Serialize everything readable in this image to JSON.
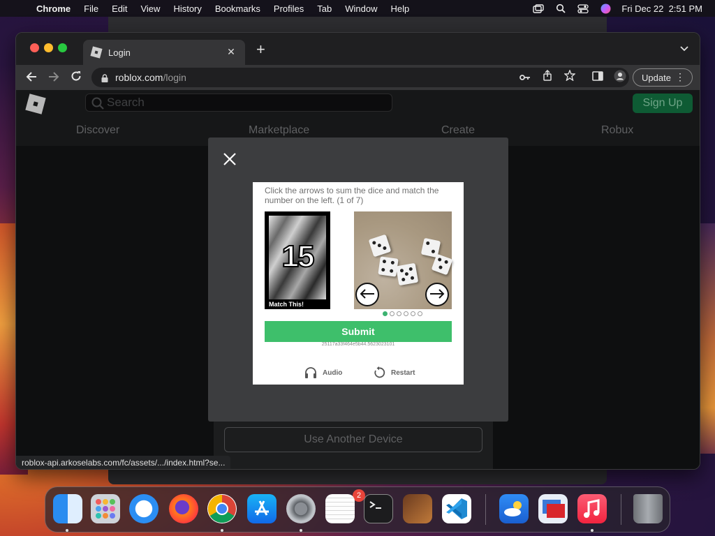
{
  "menubar": {
    "app": "Chrome",
    "items": [
      "File",
      "Edit",
      "View",
      "History",
      "Bookmarks",
      "Profiles",
      "Tab",
      "Window",
      "Help"
    ],
    "datetime": "Fri Dec 22  2:51 PM"
  },
  "browser": {
    "tab_title": "Login",
    "url_host": "roblox.com",
    "url_path": "/login",
    "update_label": "Update",
    "status_url": "roblox-api.arkoselabs.com/fc/assets/.../index.html?se..."
  },
  "roblox": {
    "search_placeholder": "Search",
    "signup_label": "Sign Up",
    "nav": [
      "Discover",
      "Marketplace",
      "Create",
      "Robux"
    ],
    "another_device_label": "Use Another Device"
  },
  "captcha": {
    "instruction": "Click the arrows to sum the dice and match the number on the left. (1 of 7)",
    "target_number": "15",
    "match_label": "Match This!",
    "submit_label": "Submit",
    "session_id": "25117a33f464e5b44.5623023101",
    "audio_label": "Audio",
    "restart_label": "Restart",
    "current_index": 1,
    "total_images": 6
  },
  "dock": {
    "apps": [
      "finder",
      "launchpad",
      "safari",
      "firefox",
      "chrome",
      "app-store",
      "system-settings",
      "textedit",
      "terminal",
      "garageband",
      "vscode",
      "weather",
      "remote-desktop",
      "music",
      "trash"
    ],
    "settings_badge": "2"
  },
  "colors": {
    "roblox_green": "#0e5b34",
    "captcha_green": "#3ebf6b",
    "modal_bg": "#3c3d3f"
  }
}
